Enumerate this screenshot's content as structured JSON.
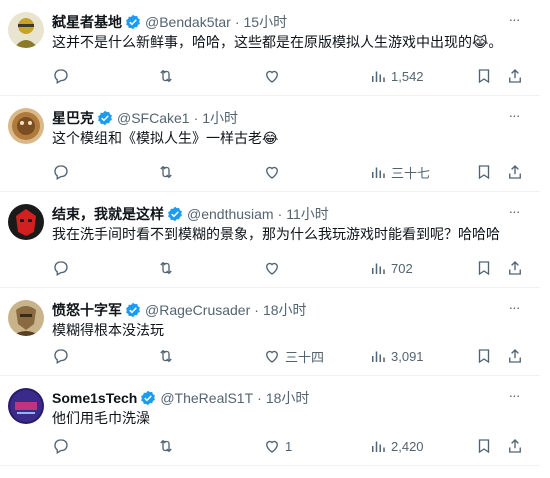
{
  "tweets": [
    {
      "name": "弑星者基地",
      "handle": "@Bendak5tar",
      "time": "15小时",
      "text": "这并不是什么新鲜事，哈哈，这些都是在原版模拟人生游戏中出现的",
      "emoji": "😹。",
      "replies": "",
      "retweets": "",
      "likes": "",
      "views": "1,542",
      "avatar_colors": [
        "#c9a227",
        "#3a3a2a"
      ]
    },
    {
      "name": "星巴克",
      "handle": "@SFCake1",
      "time": "1小时",
      "text": "这个模组和《模拟人生》一样古老",
      "emoji": "😂",
      "replies": "",
      "retweets": "",
      "likes": "",
      "views": "三十七",
      "avatar_colors": [
        "#b07a3c",
        "#5a3a1a"
      ]
    },
    {
      "name": "结束，我就是这样",
      "handle": "@endthusiam",
      "time": "11小时",
      "text": "我在洗手间时看不到模糊的景象，那为什么我玩游戏时能看到呢？哈哈哈",
      "emoji": "",
      "replies": "",
      "retweets": "",
      "likes": "",
      "views": "702",
      "avatar_colors": [
        "#d21f1f",
        "#1a1a1a"
      ]
    },
    {
      "name": "愤怒十字军",
      "handle": "@RageCrusader",
      "time": "18小时",
      "text": "模糊得根本没法玩",
      "emoji": "",
      "replies": "",
      "retweets": "",
      "likes": "三十四",
      "views": "3,091",
      "avatar_colors": [
        "#8a6a40",
        "#3a2a1a"
      ]
    },
    {
      "name": "Some1sTech",
      "handle": "@TheRealS1T",
      "time": "18小时",
      "text": "他们用毛巾洗澡",
      "emoji": "",
      "replies": "",
      "retweets": "",
      "likes": "1",
      "views": "2,420",
      "avatar_colors": [
        "#2a1a6a",
        "#c0357a"
      ]
    }
  ],
  "separator": "·",
  "more_glyph": "···",
  "colors": {
    "verified": "#1d9bf0",
    "secondary": "#536471",
    "divider": "#eff3f4"
  }
}
